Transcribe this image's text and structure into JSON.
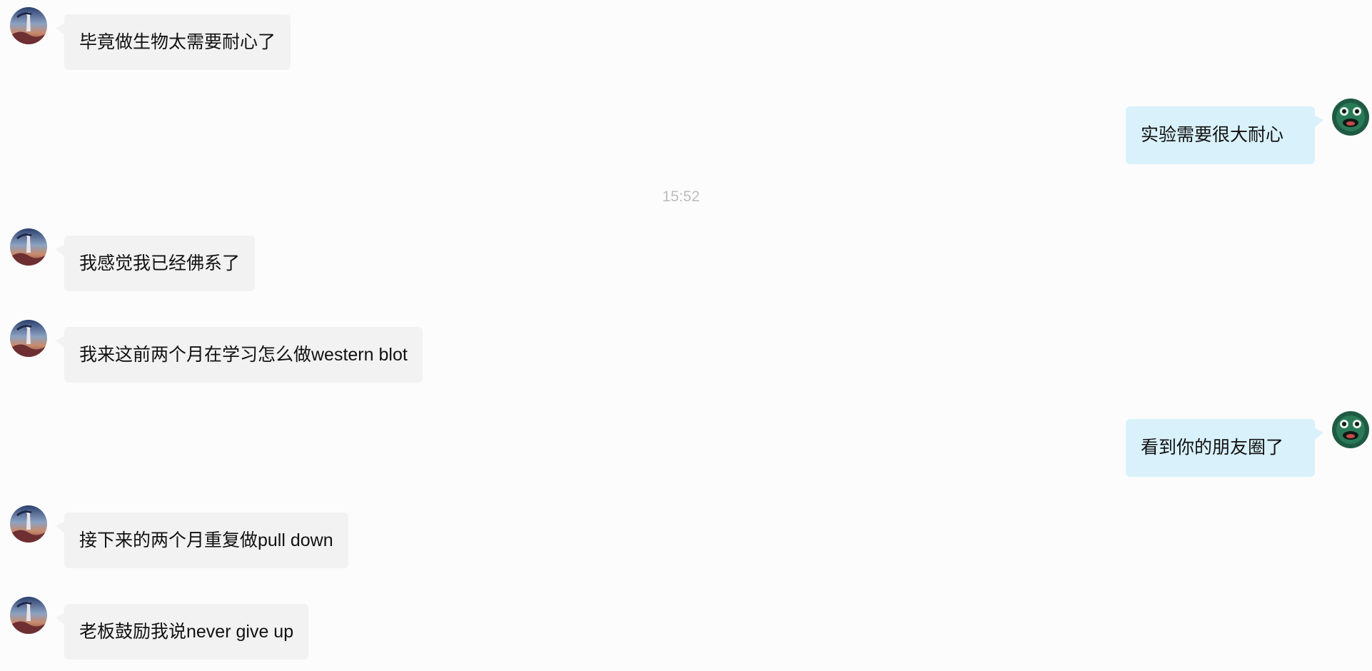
{
  "messages": [
    {
      "side": "in",
      "text": "毕竟做生物太需要耐心了",
      "avatar": "contact-avatar"
    },
    {
      "side": "out",
      "text": "实验需要很大耐心",
      "avatar": "self-avatar"
    },
    {
      "side": "in",
      "text": "我感觉我已经佛系了",
      "avatar": "contact-avatar"
    },
    {
      "side": "in",
      "text": "我来这前两个月在学习怎么做western blot",
      "avatar": "contact-avatar"
    },
    {
      "side": "out",
      "text": "看到你的朋友圈了",
      "avatar": "self-avatar"
    },
    {
      "side": "in",
      "text": "接下来的两个月重复做pull down",
      "avatar": "contact-avatar"
    },
    {
      "side": "in",
      "text": "老板鼓励我说never give up",
      "avatar": "contact-avatar"
    }
  ],
  "timestamp": "15:52",
  "colors": {
    "background": "#fcfcfc",
    "incoming_bubble": "#f2f2f2",
    "outgoing_bubble": "#d9f1fb",
    "timestamp_text": "#bdbdbd"
  }
}
